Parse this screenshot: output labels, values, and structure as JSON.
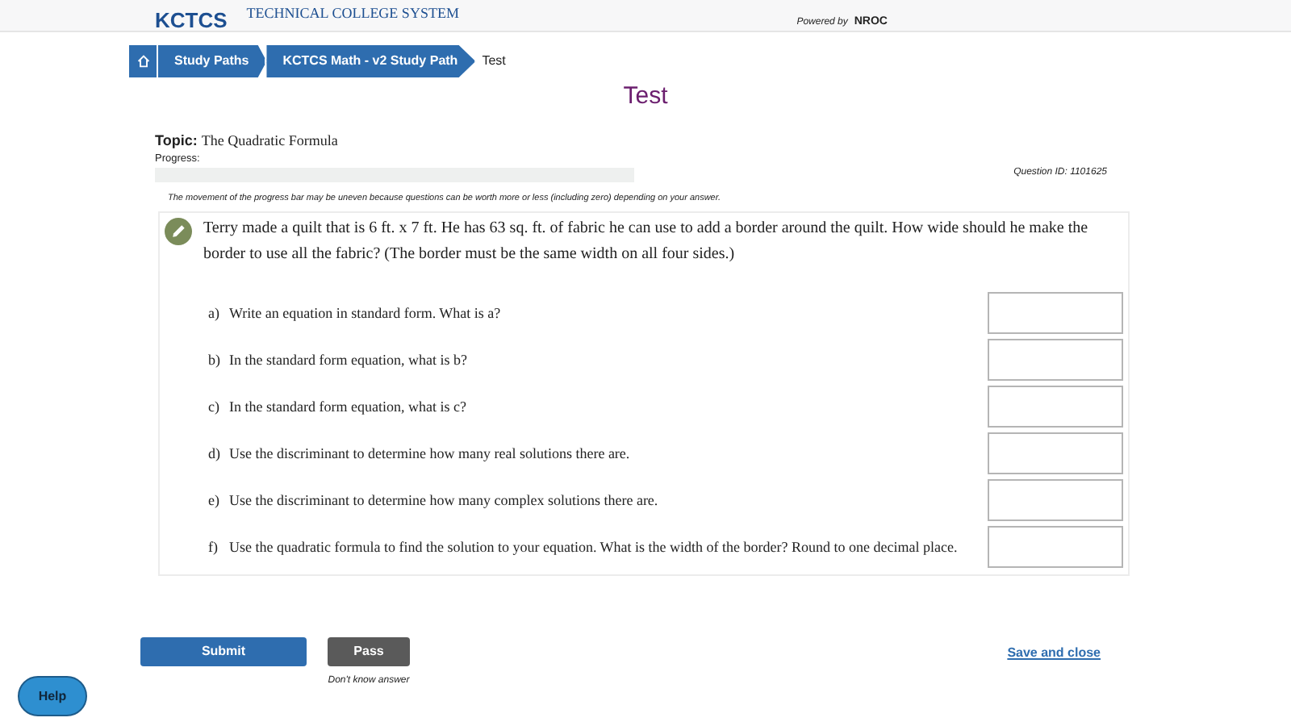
{
  "header": {
    "logo": "KCTCS",
    "subtitle": "TECHNICAL COLLEGE SYSTEM",
    "powered_by": "Powered by",
    "powered_brand": "NROC"
  },
  "breadcrumb": {
    "items": [
      "Study Paths",
      "KCTCS Math - v2 Study Path"
    ],
    "current": "Test"
  },
  "title": "Test",
  "topic": {
    "label": "Topic:",
    "value": "The Quadratic Formula"
  },
  "progress": {
    "label": "Progress:",
    "level": 0
  },
  "question_id": "Question ID: 1101625",
  "note": "The movement of the progress bar may be uneven because questions can be worth more or less (including zero) depending on your answer.",
  "question": {
    "text": "Terry made a quilt that is 6 ft. x 7 ft. He has 63 sq. ft. of fabric he can use to add a border around the quilt. How wide should he make the border to use all the fabric? (The border must be the same width on all four sides.)",
    "parts": [
      {
        "letter": "a)",
        "text": "Write an equation in standard form. What is a?"
      },
      {
        "letter": "b)",
        "text": "In the standard form equation, what is b?"
      },
      {
        "letter": "c)",
        "text": "In the standard form equation, what is c?"
      },
      {
        "letter": "d)",
        "text": "Use the discriminant to determine how many real solutions there are."
      },
      {
        "letter": "e)",
        "text": "Use the discriminant to determine how many complex solutions there are."
      },
      {
        "letter": "f)",
        "text": "Use the quadratic formula to find the solution to your equation. What is the width of the border? Round to one decimal place."
      }
    ]
  },
  "buttons": {
    "submit": "Submit",
    "pass": "Pass",
    "pass_hint": "Don't know answer",
    "save": "Save and close",
    "help": "Help"
  }
}
